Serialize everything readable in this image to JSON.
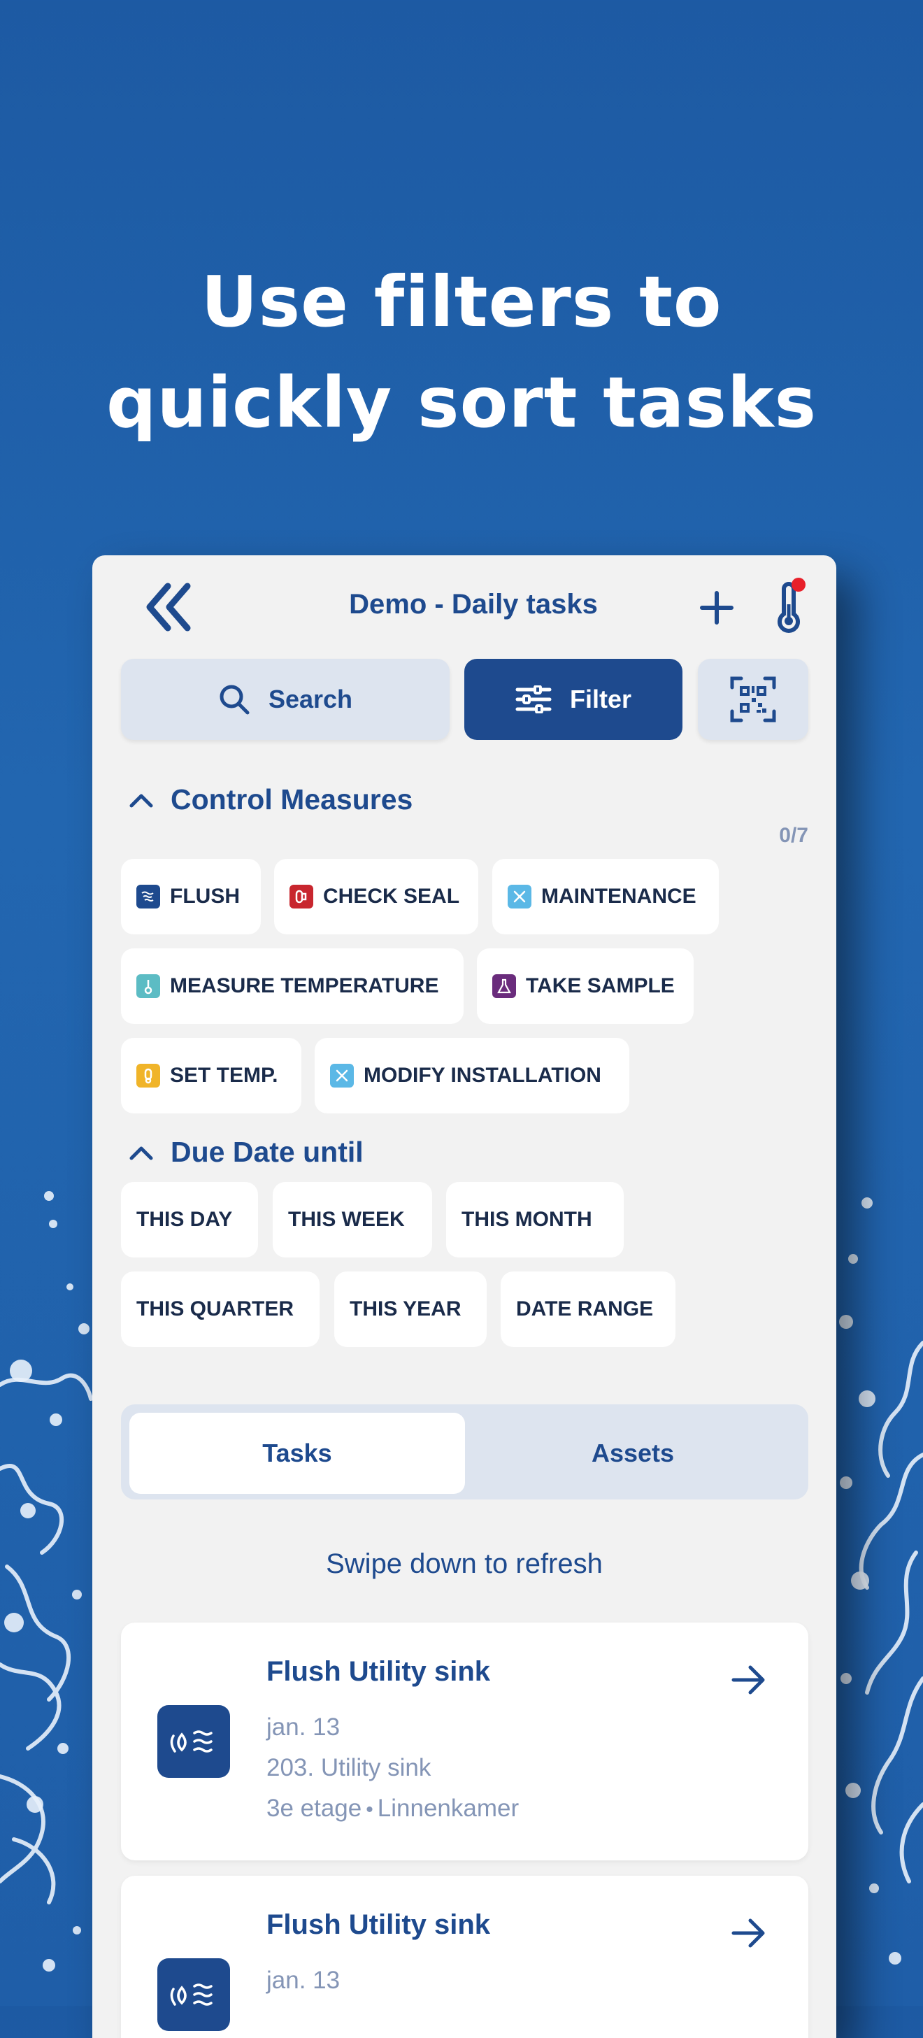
{
  "headline": {
    "line1": "Use filters to",
    "line2": "quickly sort tasks"
  },
  "app_bar": {
    "title": "Demo - Daily tasks",
    "back_icon": "double-chevron-left-icon",
    "add_icon": "plus-icon",
    "thermometer_icon": "thermometer-icon",
    "notification_color": "#e8202a"
  },
  "toolbar": {
    "search_label": "Search",
    "filter_label": "Filter",
    "qr_icon": "qr-scan-icon"
  },
  "control_measures": {
    "heading": "Control Measures",
    "count": "0/7",
    "chips": [
      {
        "label": "FLUSH",
        "icon": "flush-icon",
        "color": "#1e4a8e"
      },
      {
        "label": "CHECK SEAL",
        "icon": "seal-icon",
        "color": "#c8262e"
      },
      {
        "label": "MAINTENANCE",
        "icon": "wrench-icon",
        "color": "#5bb8e6"
      },
      {
        "label": "MEASURE TEMPERATURE",
        "icon": "thermometer-icon",
        "color": "#5cbcc4"
      },
      {
        "label": "TAKE SAMPLE",
        "icon": "flask-icon",
        "color": "#6a2c7c"
      },
      {
        "label": "SET TEMP.",
        "icon": "thermostat-icon",
        "color": "#f0b429"
      },
      {
        "label": "MODIFY INSTALLATION",
        "icon": "tools-icon",
        "color": "#5bb8e6"
      }
    ]
  },
  "due_date": {
    "heading": "Due Date until",
    "chips": [
      "THIS DAY",
      "THIS WEEK",
      "THIS MONTH",
      "THIS QUARTER",
      "THIS YEAR",
      "DATE RANGE"
    ]
  },
  "tabs": {
    "tasks": "Tasks",
    "assets": "Assets",
    "selected": "Tasks"
  },
  "refresh_hint": "Swipe down to refresh",
  "tasks": [
    {
      "title": "Flush Utility sink",
      "date": "jan. 13",
      "asset": "203. Utility sink",
      "floor": "3e etage",
      "room": "Linnenkamer",
      "icon": "flush-icon"
    },
    {
      "title": "Flush Utility sink",
      "date": "jan. 13",
      "icon": "flush-icon"
    }
  ],
  "colors": {
    "primary": "#1e4a8e",
    "background": "#2266b0",
    "card": "#ffffff",
    "panel": "#f2f2f2",
    "muted": "#8495b6"
  }
}
